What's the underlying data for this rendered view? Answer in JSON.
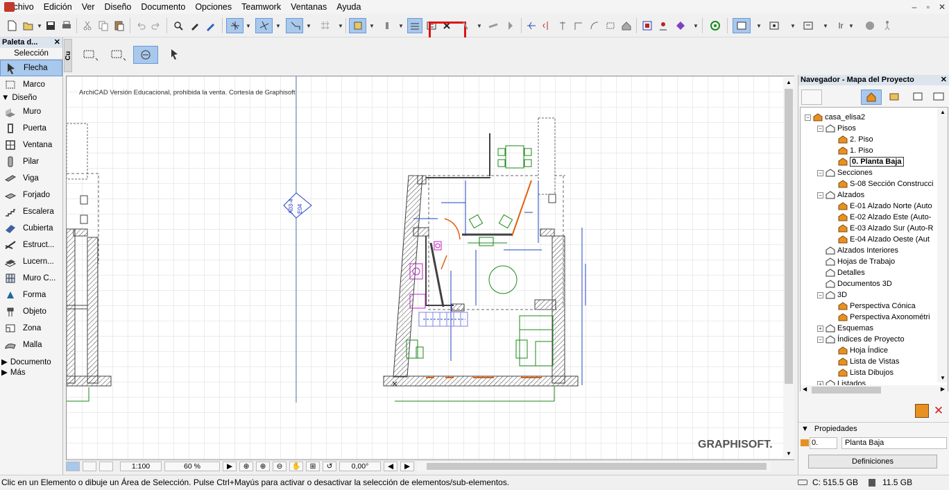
{
  "menu": [
    "Archivo",
    "Edición",
    "Ver",
    "Diseño",
    "Documento",
    "Opciones",
    "Teamwork",
    "Ventanas",
    "Ayuda"
  ],
  "window_controls": {
    "minimize": "–",
    "restore": "▫",
    "close": "✕"
  },
  "toolbar": {
    "icons": [
      "new-icon",
      "open-icon",
      "save-icon",
      "print-icon",
      "cut-icon",
      "copy-icon",
      "paste-icon",
      "undo-icon",
      "redo-icon",
      "find-select-icon",
      "eyedropper-icon",
      "inject-icon",
      "magic-wand-icon",
      "snap-guides-icon",
      "gravity-icon",
      "grid-snap-icon",
      "layer-combination-icon",
      "trace-icon",
      "section-marker-icon",
      "unlinked-marker-icon",
      "delete-marker-icon",
      "elevation-icon",
      "detail-icon",
      "worksheet-icon",
      "cut-elements-icon",
      "mirror-icon",
      "align-icon",
      "stretch-icon",
      "offset-icon",
      "split-icon",
      "roof-icon",
      "group-icon",
      "marquee-icon",
      "settings-icon",
      "render-icon",
      "view-icon",
      "layout-icon",
      "walk-icon"
    ],
    "highlighted_button": "delete-marker-icon",
    "ir_label": "Ir"
  },
  "palette": {
    "title": "Paleta d...",
    "close": "✕",
    "section_selection": "Selección",
    "selection_tools": [
      {
        "label": "Flecha",
        "icon": "arrow-icon",
        "active": true
      },
      {
        "label": "Marco",
        "icon": "marquee-icon",
        "active": false
      }
    ],
    "group_design": "Diseño",
    "design_tools": [
      {
        "label": "Muro",
        "icon": "wall-icon"
      },
      {
        "label": "Puerta",
        "icon": "door-icon"
      },
      {
        "label": "Ventana",
        "icon": "window-icon"
      },
      {
        "label": "Pilar",
        "icon": "column-icon"
      },
      {
        "label": "Viga",
        "icon": "beam-icon"
      },
      {
        "label": "Forjado",
        "icon": "slab-icon"
      },
      {
        "label": "Escalera",
        "icon": "stair-icon"
      },
      {
        "label": "Cubierta",
        "icon": "roof-icon"
      },
      {
        "label": "Estruct...",
        "icon": "shell-icon"
      },
      {
        "label": "Lucern...",
        "icon": "skylight-icon"
      },
      {
        "label": "Muro C...",
        "icon": "curtain-wall-icon"
      },
      {
        "label": "Forma",
        "icon": "morph-icon"
      },
      {
        "label": "Objeto",
        "icon": "object-icon"
      },
      {
        "label": "Zona",
        "icon": "zone-icon"
      },
      {
        "label": "Malla",
        "icon": "mesh-icon"
      }
    ],
    "group_document": "Documento",
    "group_more": "Más"
  },
  "infobox": {
    "side_tab": "Cu"
  },
  "canvas": {
    "watermark": "ArchiCAD Versión Educacional, prohibida la venta. Cortesía de Graphisoft.",
    "marker_top": "A03-4",
    "marker_bottom": "E04",
    "brand": "GRAPHISOFT."
  },
  "bottombar": {
    "scale": "1:100",
    "zoom": "60 %",
    "angle": "0,00°"
  },
  "status": {
    "message": "Clic en un Elemento o dibuje un Área de Selección. Pulse Ctrl+Mayús para activar o desactivar la selección de elementos/sub-elementos.",
    "disk": "C: 515.5 GB",
    "memory": "11.5 GB"
  },
  "navigator": {
    "title": "Navegador - Mapa del Proyecto",
    "close": "✕",
    "tree": [
      {
        "label": "casa_elisa2",
        "level": 0,
        "toggle": "−",
        "icon": "house-icon"
      },
      {
        "label": "Pisos",
        "level": 1,
        "toggle": "−",
        "icon": "stories-icon"
      },
      {
        "label": "2. Piso",
        "level": 2,
        "toggle": "",
        "icon": "story-icon"
      },
      {
        "label": "1. Piso",
        "level": 2,
        "toggle": "",
        "icon": "story-icon"
      },
      {
        "label": "0. Planta Baja",
        "level": 2,
        "toggle": "",
        "icon": "story-icon",
        "selected": true
      },
      {
        "label": "Secciones",
        "level": 1,
        "toggle": "−",
        "icon": "sections-icon"
      },
      {
        "label": "S-08 Sección Construcci",
        "level": 2,
        "toggle": "",
        "icon": "section-icon"
      },
      {
        "label": "Alzados",
        "level": 1,
        "toggle": "−",
        "icon": "elevations-icon"
      },
      {
        "label": "E-01 Alzado Norte (Auto",
        "level": 2,
        "toggle": "",
        "icon": "elevation-icon"
      },
      {
        "label": "E-02 Alzado Este (Auto-",
        "level": 2,
        "toggle": "",
        "icon": "elevation-icon"
      },
      {
        "label": "E-03 Alzado Sur (Auto-R",
        "level": 2,
        "toggle": "",
        "icon": "elevation-icon"
      },
      {
        "label": "E-04 Alzado Oeste (Aut",
        "level": 2,
        "toggle": "",
        "icon": "elevation-icon"
      },
      {
        "label": "Alzados Interiores",
        "level": 1,
        "toggle": "",
        "icon": "interior-elevations-icon"
      },
      {
        "label": "Hojas de Trabajo",
        "level": 1,
        "toggle": "",
        "icon": "worksheets-icon"
      },
      {
        "label": "Detalles",
        "level": 1,
        "toggle": "",
        "icon": "details-icon"
      },
      {
        "label": "Documentos 3D",
        "level": 1,
        "toggle": "",
        "icon": "documents-3d-icon"
      },
      {
        "label": "3D",
        "level": 1,
        "toggle": "−",
        "icon": "3d-icon"
      },
      {
        "label": "Perspectiva Cónica",
        "level": 2,
        "toggle": "",
        "icon": "perspective-icon"
      },
      {
        "label": "Perspectiva Axonométri",
        "level": 2,
        "toggle": "",
        "icon": "axonometry-icon"
      },
      {
        "label": "Esquemas",
        "level": 1,
        "toggle": "+",
        "icon": "schedules-icon"
      },
      {
        "label": "Índices de Proyecto",
        "level": 1,
        "toggle": "−",
        "icon": "project-indexes-icon"
      },
      {
        "label": "Hoja Índice",
        "level": 2,
        "toggle": "",
        "icon": "sheet-index-icon"
      },
      {
        "label": "Lista de Vistas",
        "level": 2,
        "toggle": "",
        "icon": "view-list-icon"
      },
      {
        "label": "Lista Dibujos",
        "level": 2,
        "toggle": "",
        "icon": "drawing-list-icon"
      },
      {
        "label": "Listados",
        "level": 1,
        "toggle": "+",
        "icon": "lists-icon"
      }
    ],
    "properties_label": "Propiedades",
    "story_number": "0.",
    "story_name": "Planta Baja",
    "definitions_button": "Definiciones"
  },
  "colors": {
    "accent": "#a8c8ec",
    "highlight": "#e01010",
    "walls": "#404040",
    "furniture": "#1a8a1a",
    "dimension": "#2040c0",
    "door": "#e06010",
    "sanitary": "#c020c0"
  }
}
